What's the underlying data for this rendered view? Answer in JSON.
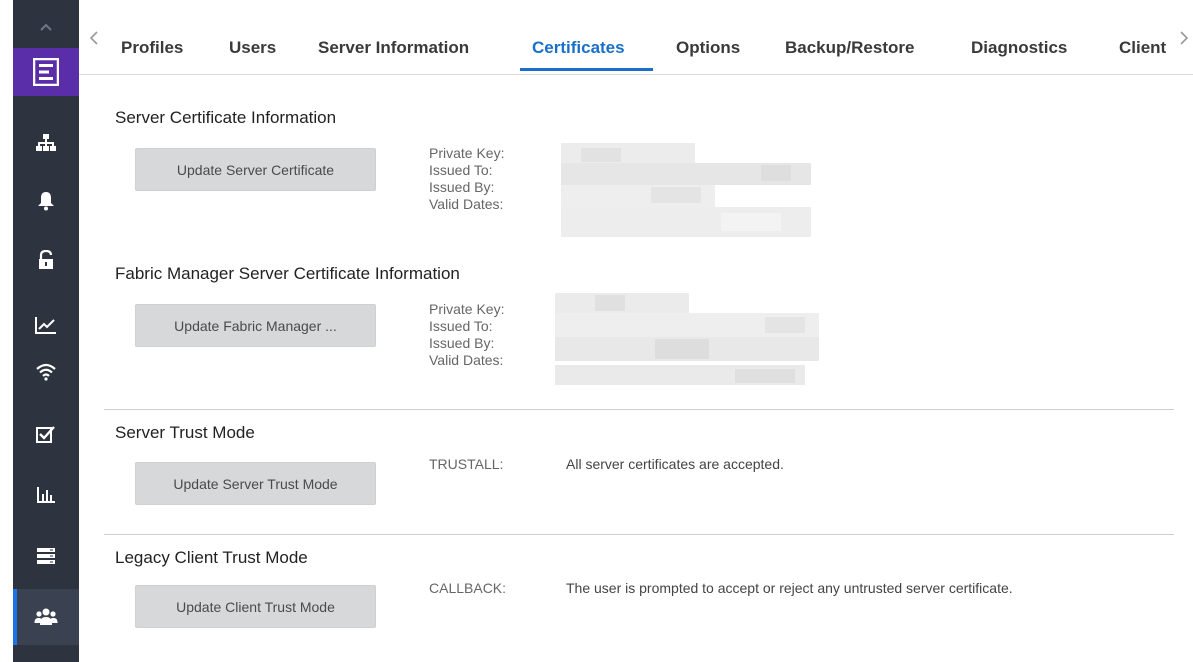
{
  "sidebar": {
    "items": [
      {
        "icon": "network-topology-icon"
      },
      {
        "icon": "alarm-bell-icon"
      },
      {
        "icon": "unlock-icon"
      },
      {
        "icon": "analytics-line-icon"
      },
      {
        "icon": "wireless-icon"
      },
      {
        "icon": "task-checkbox-icon"
      },
      {
        "icon": "reports-bar-chart-icon"
      },
      {
        "icon": "inventory-server-icon"
      },
      {
        "icon": "administration-users-icon"
      }
    ],
    "active_index": 8,
    "accent_color": "#1a73e8",
    "logo_color": "#5a2ea8"
  },
  "tabs": {
    "items": [
      "Profiles",
      "Users",
      "Server Information",
      "Certificates",
      "Options",
      "Backup/Restore",
      "Diagnostics",
      "Client"
    ],
    "active": "Certificates"
  },
  "server_cert": {
    "title": "Server Certificate Information",
    "button": "Update Server Certificate",
    "labels": [
      "Private Key:",
      "Issued To:",
      "Issued By:",
      "Valid Dates:"
    ]
  },
  "fabric_cert": {
    "title": "Fabric Manager Server Certificate Information",
    "button": "Update Fabric Manager ...",
    "labels": [
      "Private Key:",
      "Issued To:",
      "Issued By:",
      "Valid Dates:"
    ]
  },
  "server_trust": {
    "title": "Server Trust Mode",
    "button": "Update Server Trust Mode",
    "mode": "TRUSTALL:",
    "description": "All server certificates are accepted."
  },
  "client_trust": {
    "title": "Legacy Client Trust Mode",
    "button": "Update Client Trust Mode",
    "mode": "CALLBACK:",
    "description": "The user is prompted to accept or reject any untrusted server certificate."
  }
}
